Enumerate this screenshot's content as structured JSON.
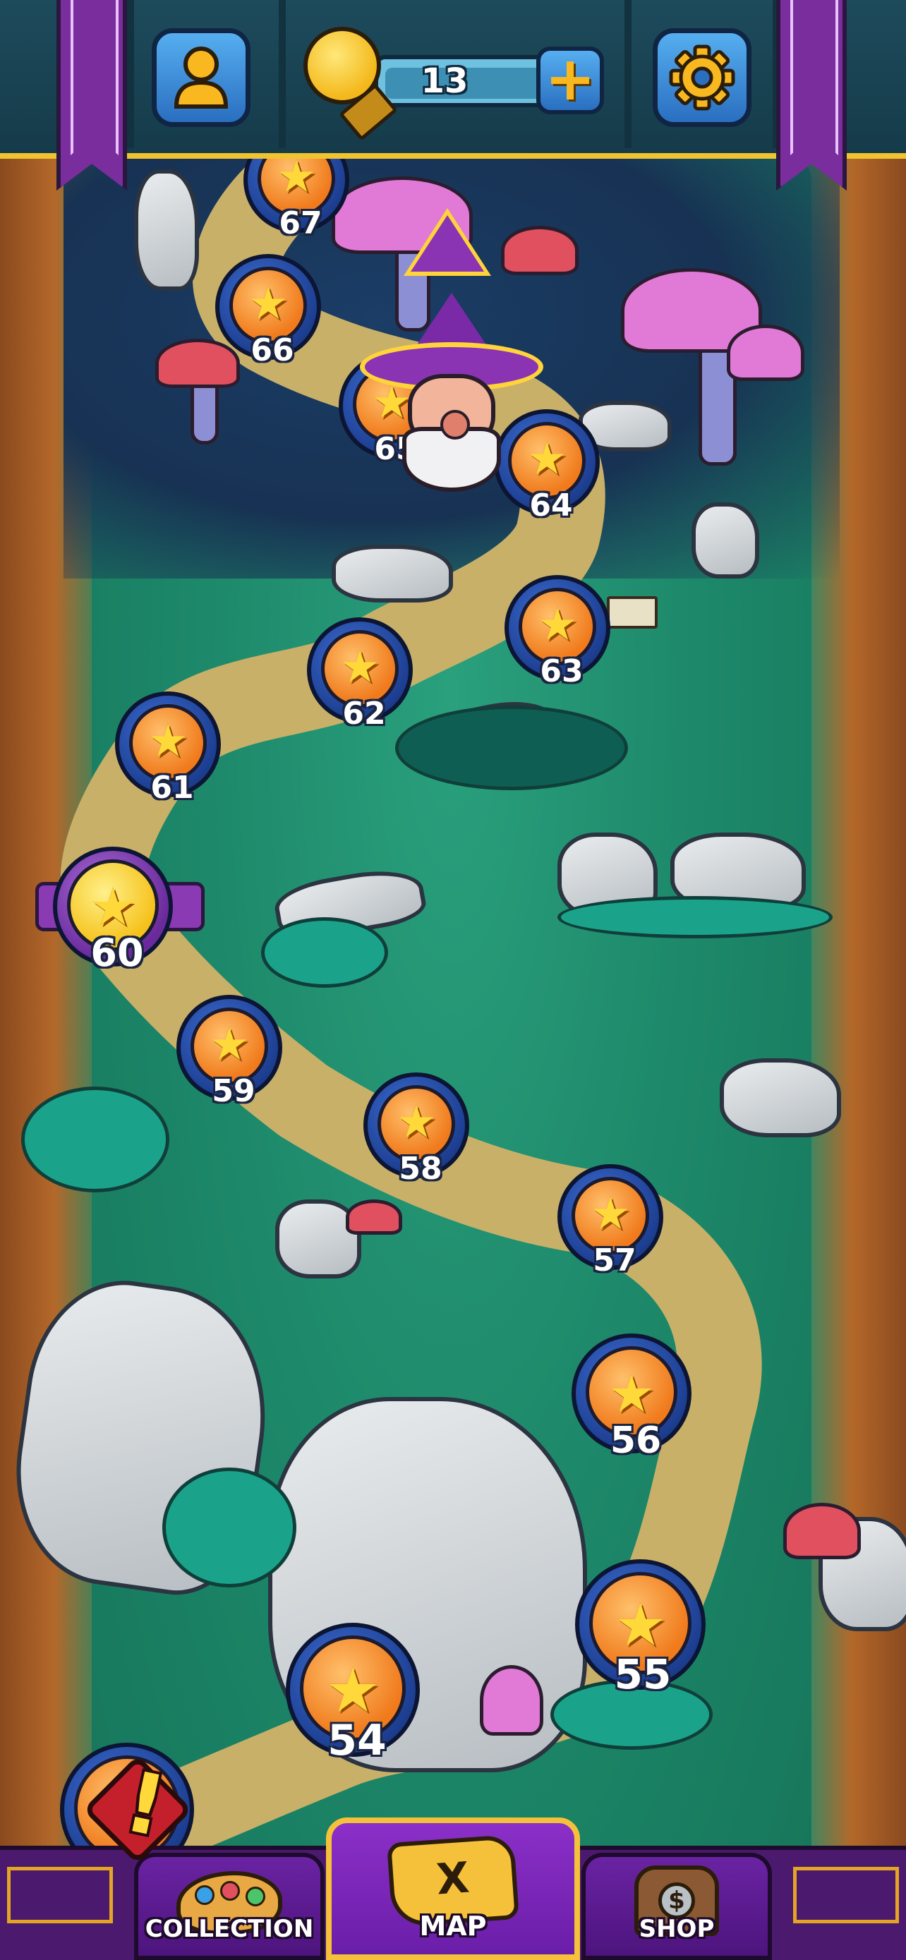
{
  "topbar": {
    "profile_icon": "person-icon",
    "hint_icon": "lightbulb-icon",
    "hint_count": "13",
    "add_hints_label": "+",
    "settings_icon": "gear-icon"
  },
  "map": {
    "current_level": "65",
    "levels": [
      {
        "number": "67",
        "state": "completed",
        "stars": 1
      },
      {
        "number": "66",
        "state": "completed",
        "stars": 1
      },
      {
        "number": "65",
        "state": "current",
        "stars": 1
      },
      {
        "number": "64",
        "state": "completed",
        "stars": 1
      },
      {
        "number": "63",
        "state": "completed",
        "stars": 1
      },
      {
        "number": "62",
        "state": "completed",
        "stars": 1
      },
      {
        "number": "61",
        "state": "completed",
        "stars": 1
      },
      {
        "number": "60",
        "state": "milestone",
        "stars": 1
      },
      {
        "number": "59",
        "state": "completed",
        "stars": 1
      },
      {
        "number": "58",
        "state": "completed",
        "stars": 1
      },
      {
        "number": "57",
        "state": "completed",
        "stars": 1
      },
      {
        "number": "56",
        "state": "completed",
        "stars": 1
      },
      {
        "number": "55",
        "state": "completed",
        "stars": 1
      },
      {
        "number": "54",
        "state": "completed",
        "stars": 1
      }
    ]
  },
  "bottom_nav": {
    "tabs": [
      {
        "label": "COLLECTION",
        "icon": "palette-icon",
        "has_alert": true
      },
      {
        "label": "MAP",
        "icon": "treasure-map-icon",
        "active": true
      },
      {
        "label": "SHOP",
        "icon": "treasure-chest-icon"
      }
    ],
    "alert_symbol": "!",
    "shop_coin_symbol": "$",
    "map_mark_symbol": "X"
  },
  "colors": {
    "accent_gold": "#f5c13a",
    "nav_purple": "#6a1ea8",
    "level_blue": "#1d3f92",
    "level_orange": "#f07a1c",
    "forest_green": "#1e8a6b"
  }
}
